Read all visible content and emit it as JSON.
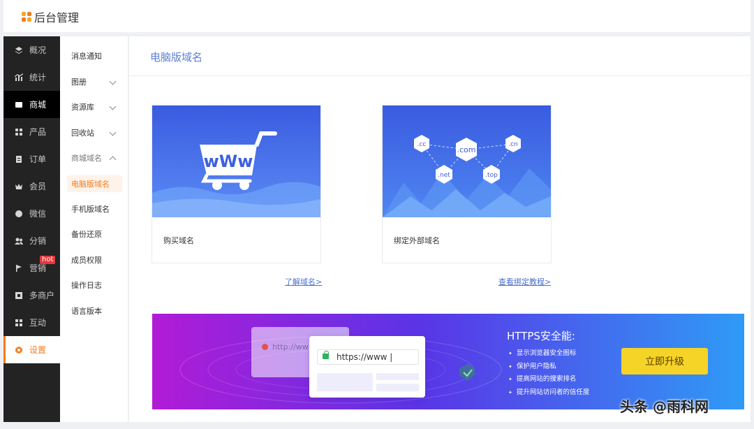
{
  "app": {
    "title": "后台管理"
  },
  "sidebar": {
    "items": [
      {
        "label": "概况",
        "icon": "layers-icon"
      },
      {
        "label": "统计",
        "icon": "chart-icon"
      },
      {
        "label": "商城",
        "icon": "mail-icon"
      },
      {
        "label": "产品",
        "icon": "grid-icon"
      },
      {
        "label": "订单",
        "icon": "clipboard-icon"
      },
      {
        "label": "会员",
        "icon": "crown-icon"
      },
      {
        "label": "微信",
        "icon": "wechat-icon"
      },
      {
        "label": "分销",
        "icon": "users-icon"
      },
      {
        "label": "营销",
        "icon": "flag-icon",
        "badge": "hot"
      },
      {
        "label": "多商户",
        "icon": "store-icon"
      },
      {
        "label": "互动",
        "icon": "apps-icon"
      },
      {
        "label": "设置",
        "icon": "gear-icon"
      }
    ]
  },
  "subnav": {
    "items": [
      {
        "label": "消息通知"
      },
      {
        "label": "图册"
      },
      {
        "label": "资源库"
      },
      {
        "label": "回收站"
      },
      {
        "label": "商城域名"
      },
      {
        "label": "电脑版域名"
      },
      {
        "label": "手机版域名"
      },
      {
        "label": "备份还原"
      },
      {
        "label": "成员权限"
      },
      {
        "label": "操作日志"
      },
      {
        "label": "语言版本"
      }
    ]
  },
  "main": {
    "title": "电脑版域名",
    "cards": [
      {
        "caption": "购买域名",
        "link": "了解域名>",
        "art_text": "wWw"
      },
      {
        "caption": "绑定外部域名",
        "link": "查看绑定教程>",
        "tags": [
          ".cc",
          ".com",
          ".cn",
          ".net",
          ".top"
        ]
      }
    ],
    "banner": {
      "title": "HTTPS安全能:",
      "features": [
        "显示浏览器安全图标",
        "保护用户隐私",
        "提高网站的搜索排名",
        "提升网站访问者的信任度"
      ],
      "button": "立即升级",
      "mock_url_back": "http://ww",
      "mock_url_front": "https://www |"
    }
  },
  "watermark": "头条 @雨科网",
  "colors": {
    "accent": "#f37b1d",
    "link": "#4b6fd0",
    "sidebar_bg": "#232323",
    "button": "#f6d327"
  }
}
